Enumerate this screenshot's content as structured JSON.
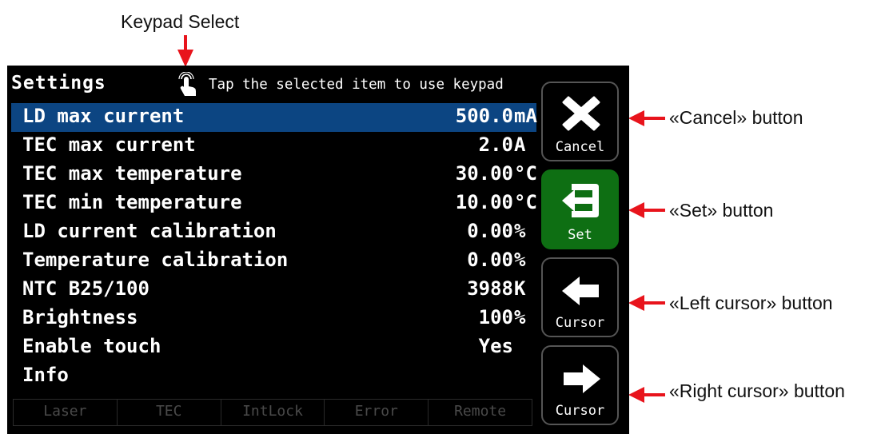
{
  "annotations": {
    "keypad_select": "Keypad Select",
    "cancel": "«Cancel» button",
    "set": "«Set» button",
    "left_cursor": "«Left cursor» button",
    "right_cursor": "«Right cursor» button"
  },
  "screen": {
    "title": "Settings",
    "hint": "Tap the selected item to use keypad",
    "items": [
      {
        "label": "LD max current",
        "value": "500.0",
        "unit": "mA",
        "selected": true
      },
      {
        "label": "TEC max current",
        "value": "2.0",
        "unit": "A",
        "selected": false
      },
      {
        "label": "TEC max temperature",
        "value": "30.00",
        "unit": "°C",
        "selected": false
      },
      {
        "label": "TEC min temperature",
        "value": "10.00",
        "unit": "°C",
        "selected": false
      },
      {
        "label": "LD current calibration",
        "value": "0.00",
        "unit": "%",
        "selected": false
      },
      {
        "label": "Temperature calibration",
        "value": "0.00",
        "unit": "%",
        "selected": false
      },
      {
        "label": "NTC B25/100",
        "value": "3988",
        "unit": "K",
        "selected": false
      },
      {
        "label": "Brightness",
        "value": "100",
        "unit": "%",
        "selected": false
      },
      {
        "label": "Enable touch",
        "value": "Yes",
        "unit": "",
        "selected": false
      },
      {
        "label": "Info",
        "value": "",
        "unit": "",
        "selected": false
      }
    ],
    "status": [
      "Laser",
      "TEC",
      "IntLock",
      "Error",
      "Remote"
    ],
    "buttons": {
      "cancel_label": "Cancel",
      "set_label": "Set",
      "left_label": "Cursor",
      "right_label": "Cursor"
    }
  },
  "colors": {
    "selected_row": "#0c4582",
    "set_button": "#0e6f13",
    "arrow": "#e8141c"
  }
}
